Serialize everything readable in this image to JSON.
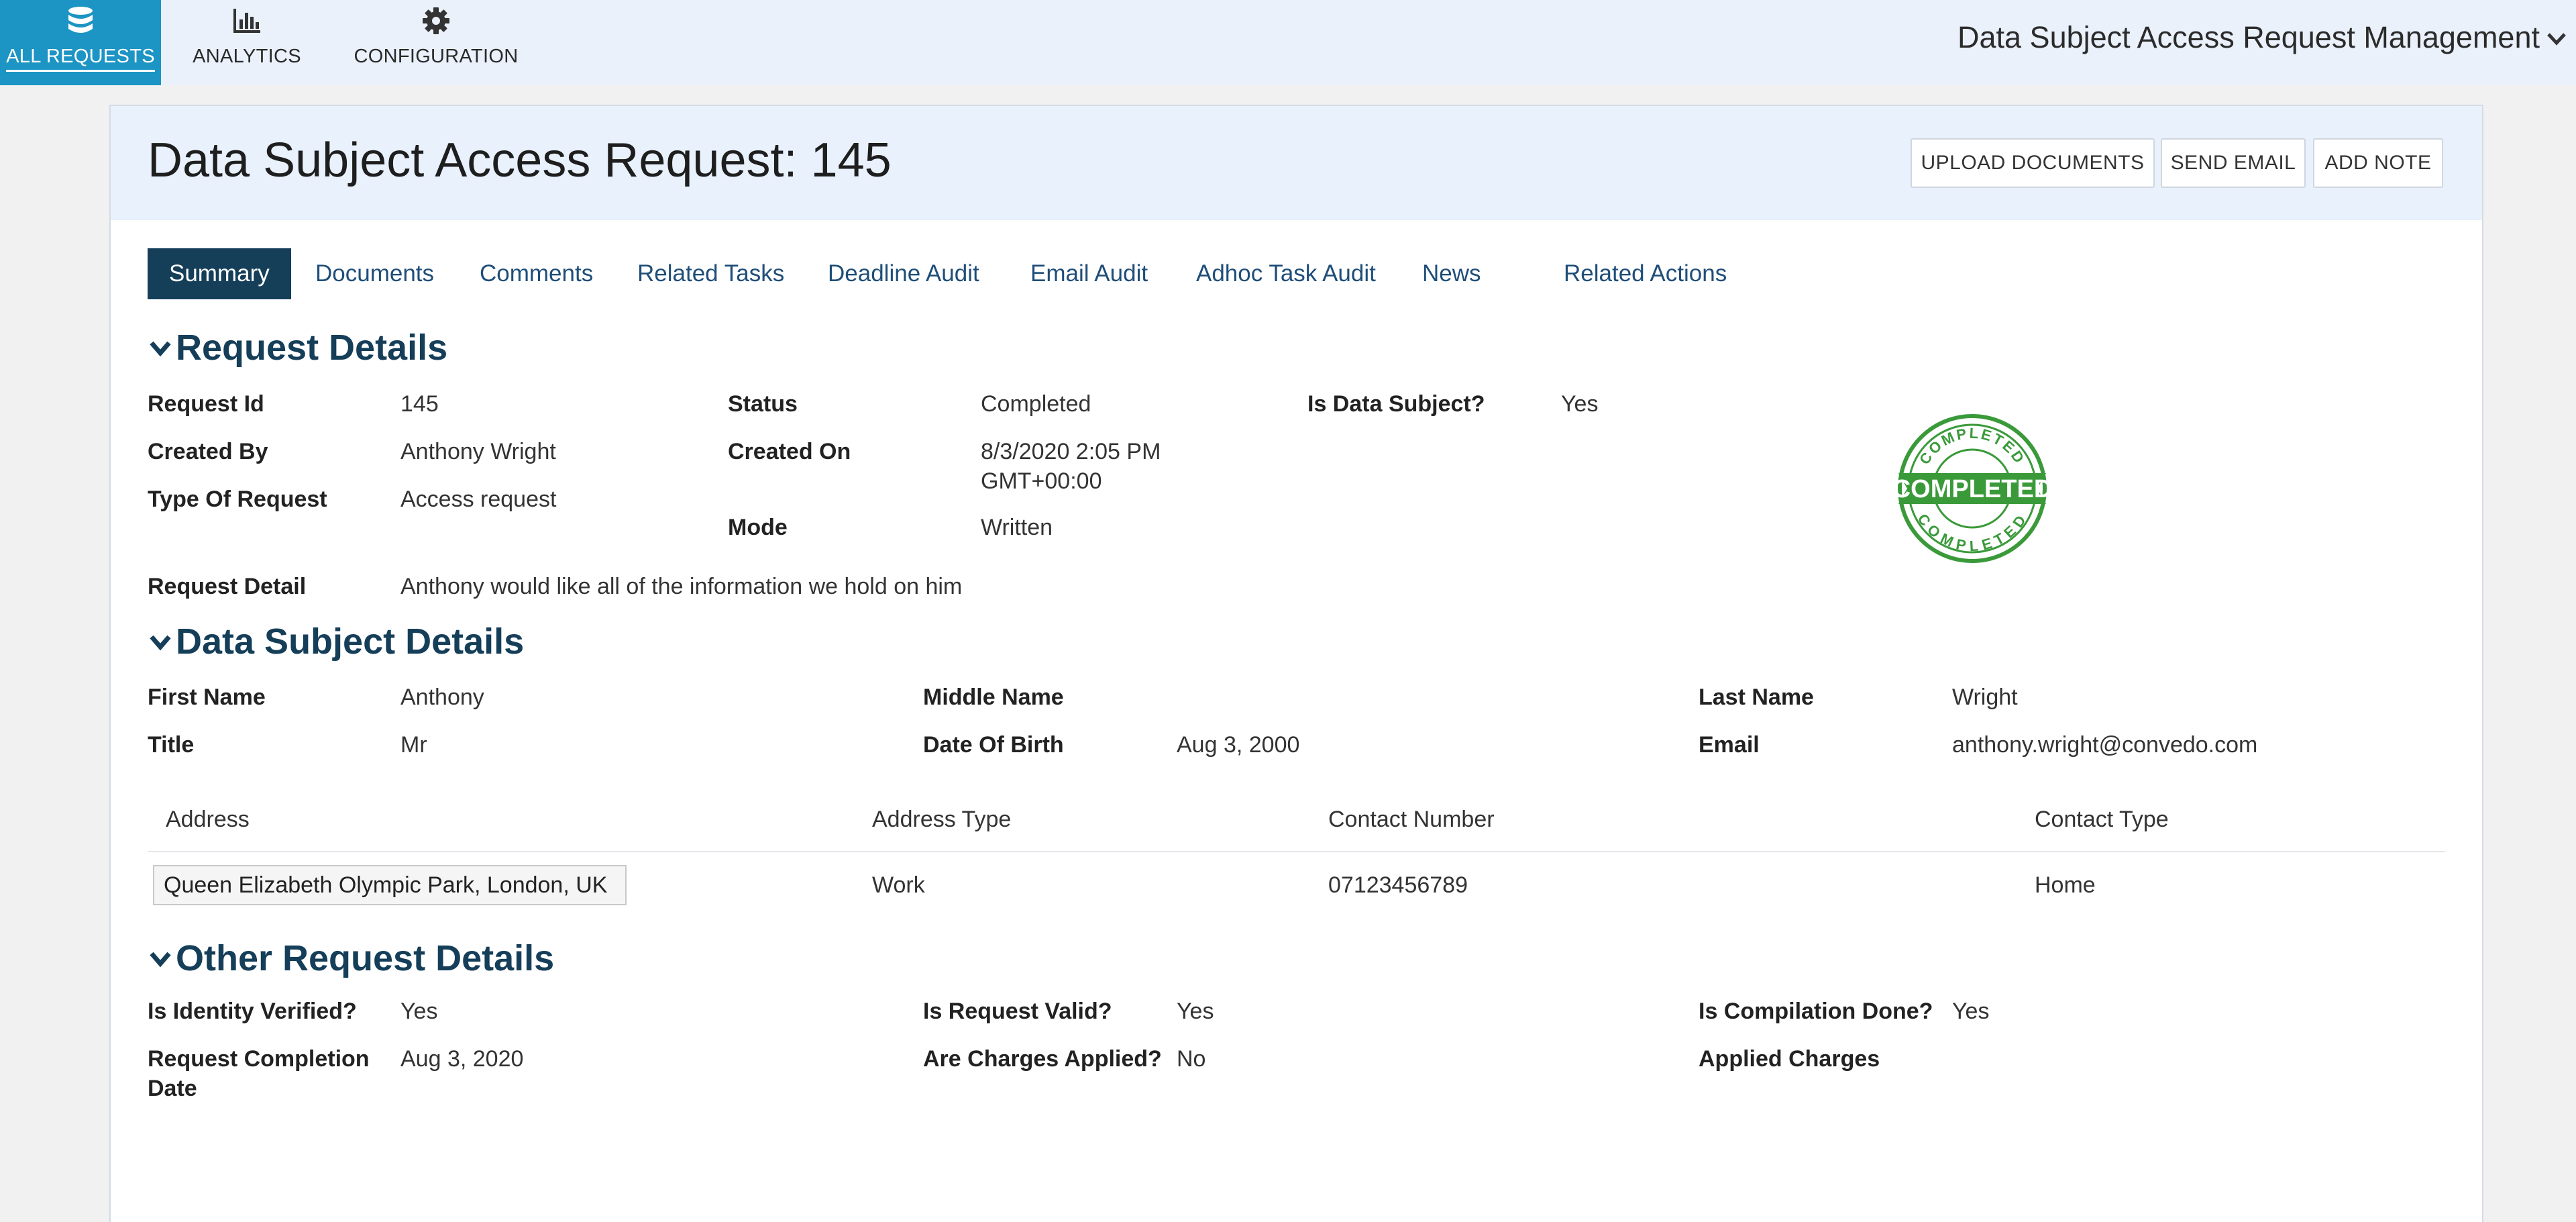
{
  "nav": {
    "items": [
      {
        "label": "ALL REQUESTS",
        "icon": "database-icon"
      },
      {
        "label": "ANALYTICS",
        "icon": "bar-chart-icon"
      },
      {
        "label": "CONFIGURATION",
        "icon": "gear-icon"
      }
    ],
    "app_title": "Data Subject Access Request Management"
  },
  "header": {
    "title": "Data Subject Access Request: 145",
    "buttons": {
      "upload": "UPLOAD DOCUMENTS",
      "email": "SEND EMAIL",
      "note": "ADD NOTE"
    }
  },
  "tabs": [
    "Summary",
    "Documents",
    "Comments",
    "Related Tasks",
    "Deadline Audit",
    "Email Audit",
    "Adhoc Task Audit",
    "News",
    "Related Actions"
  ],
  "request_details": {
    "heading": "Request Details",
    "request_id": {
      "label": "Request Id",
      "value": "145"
    },
    "created_by": {
      "label": "Created By",
      "value": "Anthony Wright"
    },
    "type_of_request": {
      "label": "Type Of Request",
      "value": "Access request"
    },
    "status": {
      "label": "Status",
      "value": "Completed"
    },
    "created_on": {
      "label": "Created On",
      "value_line1": "8/3/2020 2:05 PM",
      "value_line2": "GMT+00:00"
    },
    "mode": {
      "label": "Mode",
      "value": "Written"
    },
    "is_data_subject": {
      "label": "Is Data Subject?",
      "value": "Yes"
    },
    "request_detail": {
      "label": "Request Detail",
      "value": "Anthony would like all of the information we hold on him"
    },
    "stamp": {
      "outer_text": "COMPLETED",
      "inner_text": "COMPLETED",
      "color": "#3a9a3a"
    }
  },
  "subject_details": {
    "heading": "Data Subject Details",
    "first_name": {
      "label": "First Name",
      "value": "Anthony"
    },
    "title": {
      "label": "Title",
      "value": "Mr"
    },
    "middle_name": {
      "label": "Middle Name",
      "value": ""
    },
    "dob": {
      "label": "Date Of Birth",
      "value": "Aug 3, 2000"
    },
    "last_name": {
      "label": "Last Name",
      "value": "Wright"
    },
    "email": {
      "label": "Email",
      "value": "anthony.wright@convedo.com"
    },
    "address_table": {
      "headers": [
        "Address",
        "Address Type"
      ],
      "rows": [
        [
          "Queen Elizabeth Olympic Park, London, UK",
          "Work"
        ]
      ]
    },
    "contact_table": {
      "headers": [
        "Contact Number",
        "Contact Type"
      ],
      "rows": [
        [
          "07123456789",
          "Home"
        ]
      ]
    }
  },
  "other_details": {
    "heading": "Other Request Details",
    "identity_verified": {
      "label": "Is Identity Verified?",
      "value": "Yes"
    },
    "completion_date": {
      "label_line1": "Request Completion",
      "label_line2": "Date",
      "value": "Aug 3, 2020"
    },
    "request_valid": {
      "label": "Is Request Valid?",
      "value": "Yes"
    },
    "charges_applied": {
      "label": "Are Charges Applied?",
      "value": "No"
    },
    "compilation_done": {
      "label": "Is Compilation Done?",
      "value": "Yes"
    },
    "applied_charges": {
      "label": "Applied Charges",
      "value": ""
    }
  },
  "colors": {
    "accent": "#1c94c4",
    "heading": "#153e59",
    "tab_link": "#1f4e79",
    "header_bg": "#e8f1fc"
  }
}
